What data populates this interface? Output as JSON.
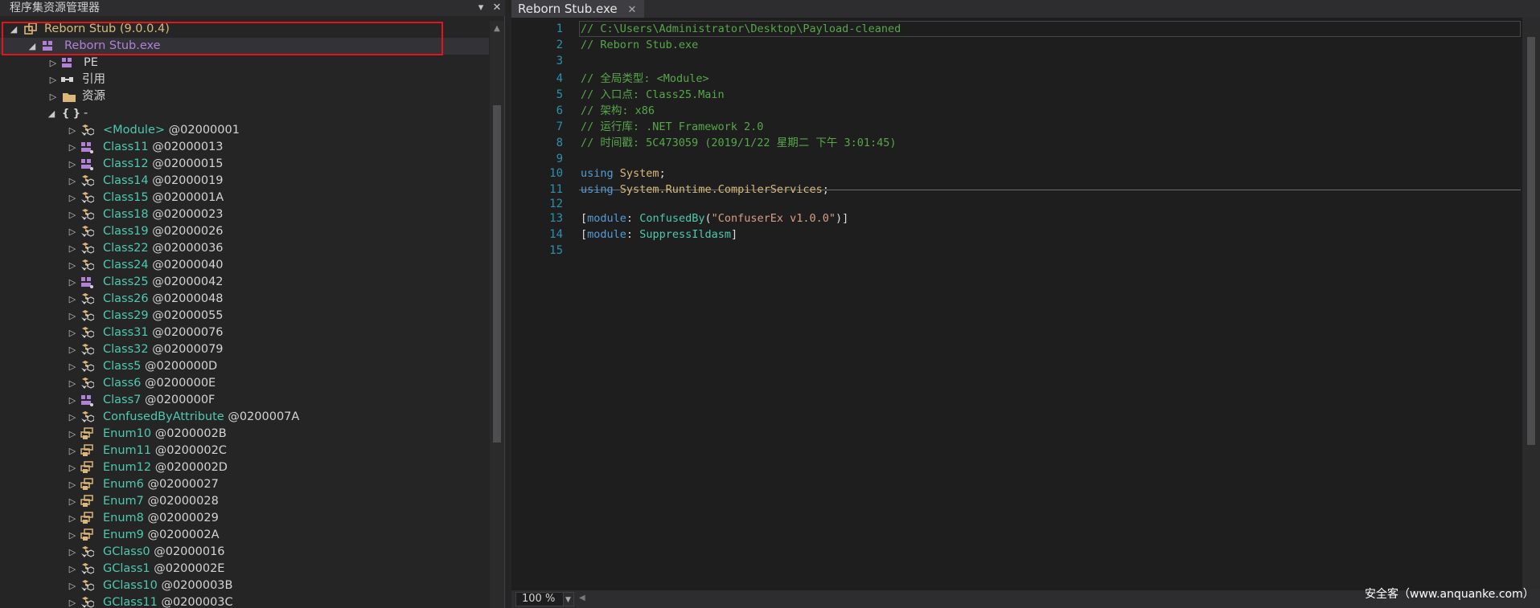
{
  "explorer": {
    "title": "程序集资源管理器",
    "pin_icon": "▾",
    "close_icon": "✕"
  },
  "tree": {
    "assembly": {
      "label": "Reborn Stub (9.0.0.4)"
    },
    "module": {
      "label": "Reborn Stub.exe"
    },
    "pe": {
      "label": "PE"
    },
    "references": {
      "label": "引用"
    },
    "resources": {
      "label": "资源"
    },
    "namespace": {
      "label": "-"
    },
    "types": [
      {
        "name": "<Module>",
        "token": "@02000001",
        "kind": "class"
      },
      {
        "name": "Class11",
        "token": "@02000013",
        "kind": "static"
      },
      {
        "name": "Class12",
        "token": "@02000015",
        "kind": "static"
      },
      {
        "name": "Class14",
        "token": "@02000019",
        "kind": "class"
      },
      {
        "name": "Class15",
        "token": "@0200001A",
        "kind": "class"
      },
      {
        "name": "Class18",
        "token": "@02000023",
        "kind": "class"
      },
      {
        "name": "Class19",
        "token": "@02000026",
        "kind": "class"
      },
      {
        "name": "Class22",
        "token": "@02000036",
        "kind": "class"
      },
      {
        "name": "Class24",
        "token": "@02000040",
        "kind": "class"
      },
      {
        "name": "Class25",
        "token": "@02000042",
        "kind": "static"
      },
      {
        "name": "Class26",
        "token": "@02000048",
        "kind": "class"
      },
      {
        "name": "Class29",
        "token": "@02000055",
        "kind": "class"
      },
      {
        "name": "Class31",
        "token": "@02000076",
        "kind": "class"
      },
      {
        "name": "Class32",
        "token": "@02000079",
        "kind": "class"
      },
      {
        "name": "Class5",
        "token": "@0200000D",
        "kind": "class"
      },
      {
        "name": "Class6",
        "token": "@0200000E",
        "kind": "class"
      },
      {
        "name": "Class7",
        "token": "@0200000F",
        "kind": "static"
      },
      {
        "name": "ConfusedByAttribute",
        "token": "@0200007A",
        "kind": "class"
      },
      {
        "name": "Enum10",
        "token": "@0200002B",
        "kind": "enum"
      },
      {
        "name": "Enum11",
        "token": "@0200002C",
        "kind": "enum"
      },
      {
        "name": "Enum12",
        "token": "@0200002D",
        "kind": "enum"
      },
      {
        "name": "Enum6",
        "token": "@02000027",
        "kind": "enum"
      },
      {
        "name": "Enum7",
        "token": "@02000028",
        "kind": "enum"
      },
      {
        "name": "Enum8",
        "token": "@02000029",
        "kind": "enum"
      },
      {
        "name": "Enum9",
        "token": "@0200002A",
        "kind": "enum"
      },
      {
        "name": "GClass0",
        "token": "@02000016",
        "kind": "class"
      },
      {
        "name": "GClass1",
        "token": "@0200002E",
        "kind": "class"
      },
      {
        "name": "GClass10",
        "token": "@0200003B",
        "kind": "class"
      },
      {
        "name": "GClass11",
        "token": "@0200003C",
        "kind": "class"
      }
    ]
  },
  "editor": {
    "tab_title": "Reborn Stub.exe",
    "tab_close": "✕",
    "zoom": "100 %",
    "lines": [
      {
        "n": "1",
        "parts": [
          {
            "t": "// C:\\Users\\Administrator\\Desktop\\Payload-cleaned",
            "c": "c-comment"
          }
        ]
      },
      {
        "n": "2",
        "parts": [
          {
            "t": "// Reborn Stub.exe",
            "c": "c-comment"
          }
        ]
      },
      {
        "n": "3",
        "parts": []
      },
      {
        "n": "4",
        "parts": [
          {
            "t": "// 全局类型: <Module>",
            "c": "c-comment"
          }
        ]
      },
      {
        "n": "5",
        "parts": [
          {
            "t": "// 入口点: Class25.Main",
            "c": "c-comment"
          }
        ]
      },
      {
        "n": "6",
        "parts": [
          {
            "t": "// 架构: x86",
            "c": "c-comment"
          }
        ]
      },
      {
        "n": "7",
        "parts": [
          {
            "t": "// 运行库: .NET Framework 2.0",
            "c": "c-comment"
          }
        ]
      },
      {
        "n": "8",
        "parts": [
          {
            "t": "// 时间戳: 5C473059 (2019/1/22 星期二 下午 3:01:45)",
            "c": "c-comment"
          }
        ]
      },
      {
        "n": "9",
        "parts": []
      },
      {
        "n": "10",
        "parts": [
          {
            "t": "using ",
            "c": "c-kw"
          },
          {
            "t": "System",
            "c": "c-ns"
          },
          {
            "t": ";",
            "c": "c-plain"
          }
        ]
      },
      {
        "n": "11",
        "parts": [
          {
            "t": "using ",
            "c": "c-kw"
          },
          {
            "t": "System.Runtime.CompilerServices",
            "c": "c-ns"
          },
          {
            "t": ";",
            "c": "c-plain"
          }
        ]
      },
      {
        "n": "12",
        "parts": []
      },
      {
        "n": "13",
        "parts": [
          {
            "t": "[",
            "c": "c-plain"
          },
          {
            "t": "module",
            "c": "c-kw"
          },
          {
            "t": ": ",
            "c": "c-plain"
          },
          {
            "t": "ConfusedBy",
            "c": "c-type"
          },
          {
            "t": "(",
            "c": "c-plain"
          },
          {
            "t": "\"ConfuserEx v1.0.0\"",
            "c": "c-str"
          },
          {
            "t": ")]",
            "c": "c-plain"
          }
        ]
      },
      {
        "n": "14",
        "parts": [
          {
            "t": "[",
            "c": "c-plain"
          },
          {
            "t": "module",
            "c": "c-kw"
          },
          {
            "t": ": ",
            "c": "c-plain"
          },
          {
            "t": "SuppressIldasm",
            "c": "c-type"
          },
          {
            "t": "]",
            "c": "c-plain"
          }
        ]
      },
      {
        "n": "15",
        "parts": []
      }
    ]
  },
  "watermark": "安全客（www.anquanke.com）",
  "colors": {
    "type_name": "#4ec9b0",
    "assembly_name": "#d7ba7d",
    "module_name": "#b180d7",
    "highlight_border": "#e0161d"
  }
}
